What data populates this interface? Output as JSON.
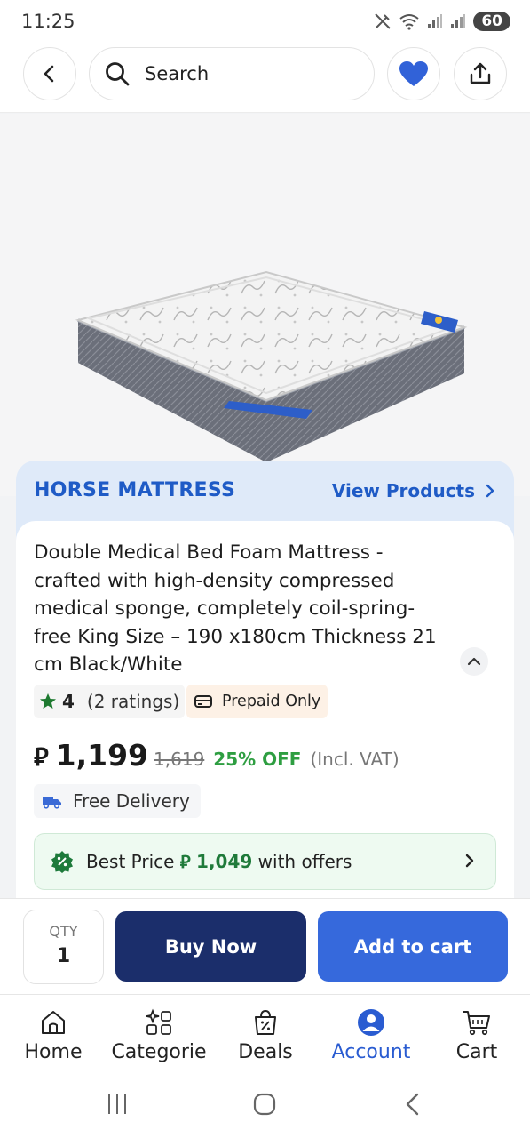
{
  "status_bar": {
    "time": "11:25",
    "battery": "60"
  },
  "header": {
    "search_placeholder": "Search"
  },
  "brand": {
    "name": "HORSE MATTRESS",
    "view_products": "View Products"
  },
  "product": {
    "title": "Double Medical Bed Foam Mattress - crafted with high-density compressed medical sponge, completely coil-spring-free King Size – 190 x180cm Thickness 21 cm Black/White",
    "rating": "4",
    "rating_count": "(2 ratings)",
    "payment_tag": "Prepaid Only",
    "currency_symbol": "⃁",
    "price": "1,199",
    "old_price": "1,619",
    "discount": "25% OFF",
    "vat_note": "(Incl. VAT)",
    "delivery": "Free Delivery"
  },
  "offer": {
    "label": "Best Price",
    "currency_symbol": "⃁",
    "price": "1,049",
    "suffix": "with offers"
  },
  "actions": {
    "qty_label": "QTY",
    "qty_value": "1",
    "buy_now": "Buy Now",
    "add_to_cart": "Add to cart"
  },
  "bottom_nav": {
    "items": [
      {
        "label": "Home"
      },
      {
        "label": "Categorie"
      },
      {
        "label": "Deals"
      },
      {
        "label": "Account"
      },
      {
        "label": "Cart"
      }
    ]
  },
  "colors": {
    "brand_blue": "#1f5bc6",
    "buy_now_bg": "#1b2e6b",
    "add_cart_bg": "#3669dc",
    "discount_green": "#2e9e41",
    "offer_bg": "#eefaf1"
  }
}
